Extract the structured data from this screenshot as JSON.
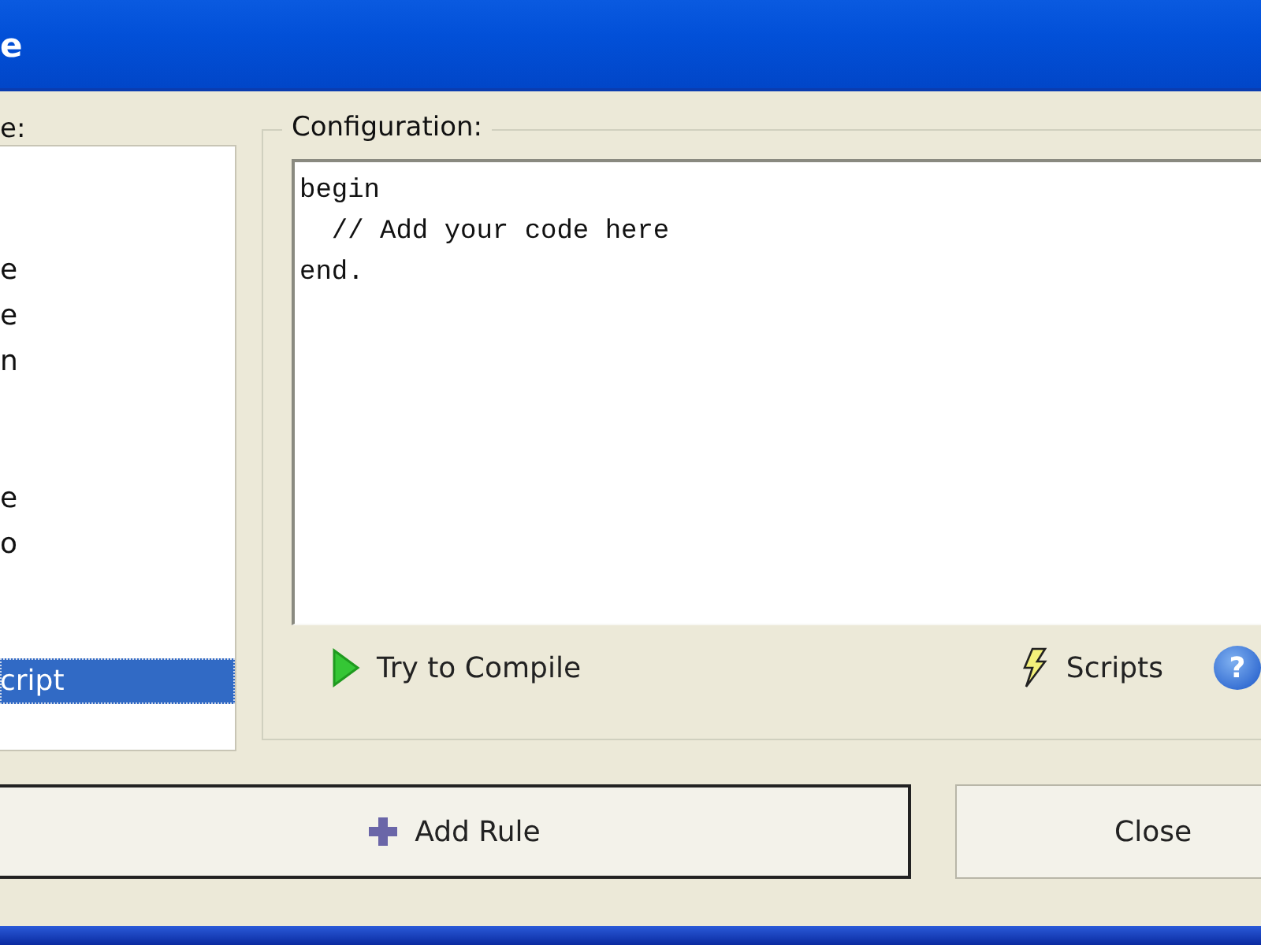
{
  "window": {
    "title": "e"
  },
  "list": {
    "label": "e:",
    "items": [
      {
        "text": "e",
        "selected": false
      },
      {
        "text": "e",
        "selected": false
      },
      {
        "text": "n",
        "selected": false
      },
      {
        "text": "e",
        "selected": false
      },
      {
        "text": "o",
        "selected": false
      },
      {
        "text": "cript",
        "selected": true
      }
    ]
  },
  "configuration": {
    "label": "Configuration:",
    "code": [
      "begin",
      "  // Add your code here",
      "end."
    ],
    "toolbar": [
      {
        "kind": "compile",
        "label": "Try to Compile"
      },
      {
        "kind": "scripts",
        "label": "Scripts"
      },
      {
        "kind": "help",
        "label": "?"
      }
    ]
  },
  "buttons": [
    {
      "kind": "add",
      "label": "Add Rule"
    },
    {
      "kind": "close",
      "label": "Close"
    }
  ]
}
